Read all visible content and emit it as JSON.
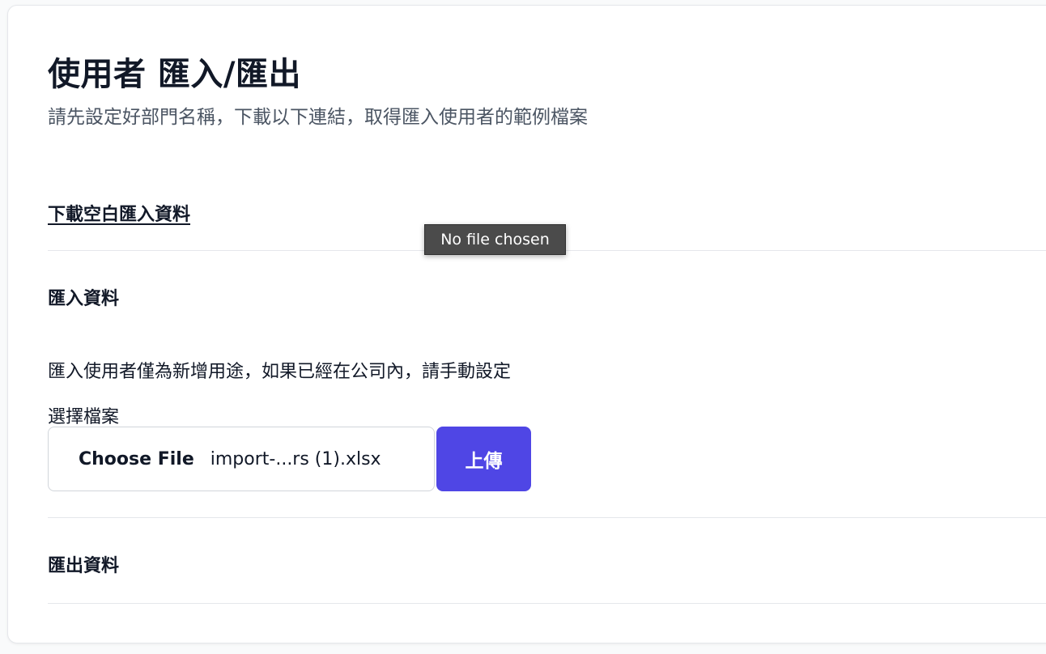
{
  "header": {
    "title": "使用者 匯入/匯出",
    "subtitle": "請先設定好部門名稱，下載以下連結，取得匯入使用者的範例檔案"
  },
  "download": {
    "link_text": "下載空白匯入資料"
  },
  "import_section": {
    "heading": "匯入資料",
    "notice": "匯入使用者僅為新增用途，如果已經在公司內，請手動設定",
    "field_label": "選擇檔案",
    "choose_file_label": "Choose File",
    "file_name": "import-...rs (1).xlsx",
    "upload_label": "上傳"
  },
  "export_section": {
    "heading": "匯出資料"
  },
  "tooltip": {
    "text": "No file chosen"
  },
  "colors": {
    "primary": "#4f46e5",
    "text": "#111827",
    "muted": "#4b5563",
    "divider": "#e5e7eb"
  }
}
